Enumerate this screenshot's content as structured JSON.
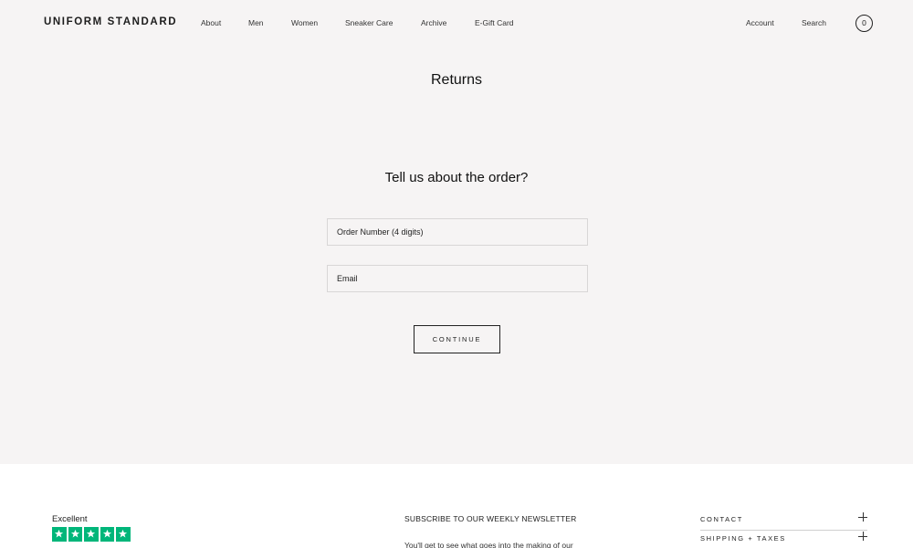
{
  "header": {
    "logo": "UNIFORM STANDARD",
    "nav": [
      "About",
      "Men",
      "Women",
      "Sneaker Care",
      "Archive",
      "E-Gift Card"
    ],
    "account": "Account",
    "search": "Search",
    "cart_count": "0"
  },
  "main": {
    "title": "Returns",
    "form_heading": "Tell us about the order?",
    "order_placeholder": "Order Number (4 digits)",
    "email_placeholder": "Email",
    "continue_label": "CONTINUE"
  },
  "footer": {
    "trustpilot": {
      "label": "Excellent",
      "stars": 5,
      "star_color": "#00b67a",
      "icon": "star-icon"
    },
    "newsletter": {
      "title": "SUBSCRIBE TO OUR WEEKLY NEWSLETTER",
      "text": "You'll get to see what goes into the making of our"
    },
    "accordion": [
      "CONTACT",
      "SHIPPING + TAXES"
    ]
  },
  "colors": {
    "page_bg": "#f6f4f4",
    "footer_bg": "#ffffff",
    "text": "#1a1a1a",
    "accent_green": "#00b67a"
  }
}
